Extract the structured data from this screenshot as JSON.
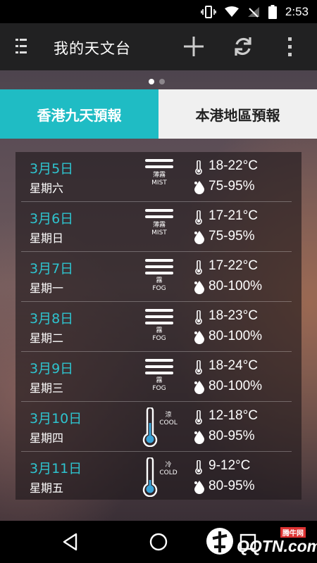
{
  "status_bar": {
    "time": "2:53"
  },
  "app_bar": {
    "title": "我的天文台"
  },
  "tabs": [
    {
      "label": "香港九天預報",
      "active": true
    },
    {
      "label": "本港地區預報",
      "active": false
    }
  ],
  "forecast": [
    {
      "date": "3月5日",
      "weekday": "星期六",
      "condition_cn": "薄霧",
      "condition_en": "MIST",
      "icon": "mist-icon",
      "temperature": "18-22°C",
      "humidity": "75-95%"
    },
    {
      "date": "3月6日",
      "weekday": "星期日",
      "condition_cn": "薄霧",
      "condition_en": "MIST",
      "icon": "mist-icon",
      "temperature": "17-21°C",
      "humidity": "75-95%"
    },
    {
      "date": "3月7日",
      "weekday": "星期一",
      "condition_cn": "霧",
      "condition_en": "FOG",
      "icon": "fog-icon",
      "temperature": "17-22°C",
      "humidity": "80-100%"
    },
    {
      "date": "3月8日",
      "weekday": "星期二",
      "condition_cn": "霧",
      "condition_en": "FOG",
      "icon": "fog-icon",
      "temperature": "18-23°C",
      "humidity": "80-100%"
    },
    {
      "date": "3月9日",
      "weekday": "星期三",
      "condition_cn": "霧",
      "condition_en": "FOG",
      "icon": "fog-icon",
      "temperature": "18-24°C",
      "humidity": "80-100%"
    },
    {
      "date": "3月10日",
      "weekday": "星期四",
      "condition_cn": "涼",
      "condition_en": "COOL",
      "icon": "thermometer-cool-icon",
      "temperature": "12-18°C",
      "humidity": "80-95%"
    },
    {
      "date": "3月11日",
      "weekday": "星期五",
      "condition_cn": "冷",
      "condition_en": "COLD",
      "icon": "thermometer-cold-icon",
      "temperature": "9-12°C",
      "humidity": "80-95%"
    }
  ],
  "watermark": {
    "site_cn": "腾牛网",
    "site_en": "QQTN.com"
  },
  "colors": {
    "accent": "#1fbcc4",
    "date_text": "#2ec4cf",
    "cold_blue": "#3aa3d8"
  }
}
